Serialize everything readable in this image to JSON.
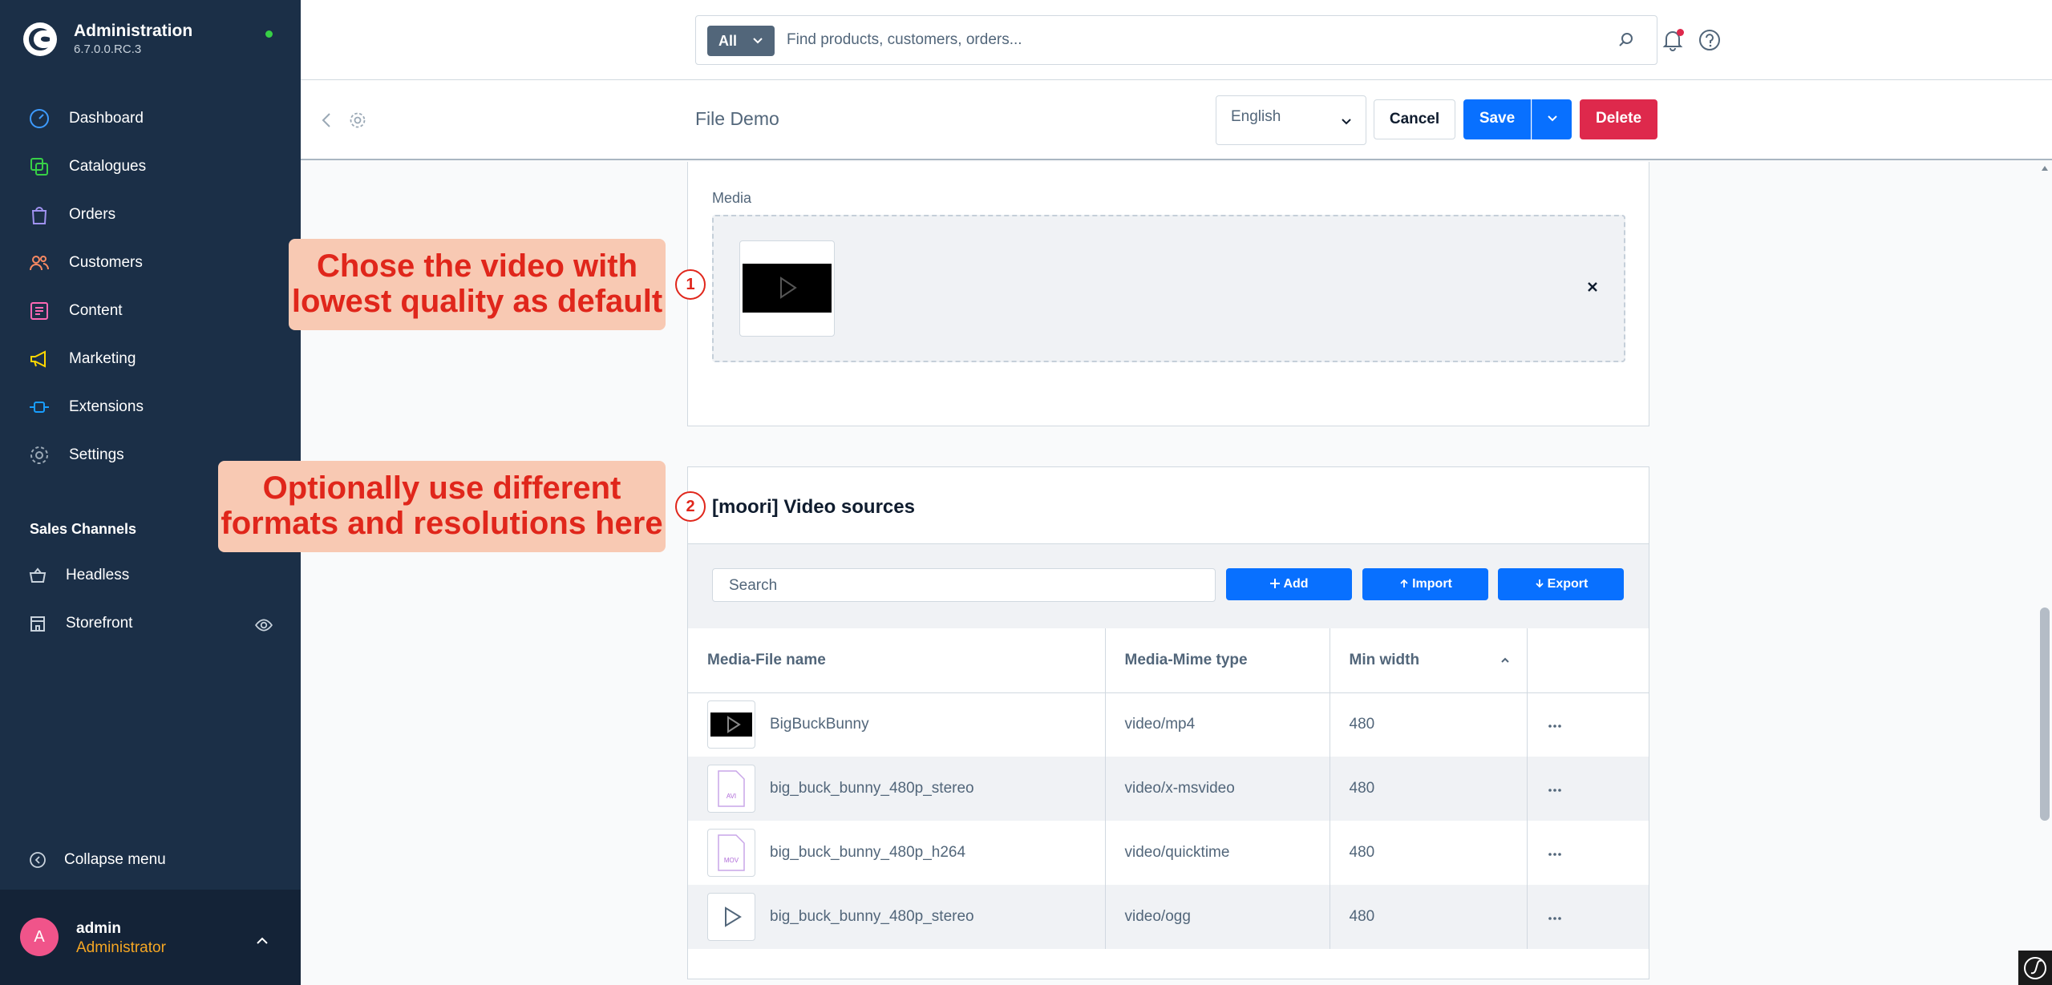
{
  "app": {
    "title": "Administration",
    "version": "6.7.0.0.RC.3"
  },
  "sidebar": {
    "items": [
      {
        "label": "Dashboard",
        "icon": "gauge-icon",
        "color": "#3d9bff"
      },
      {
        "label": "Catalogues",
        "icon": "catalogue-icon",
        "color": "#37d046"
      },
      {
        "label": "Orders",
        "icon": "bag-icon",
        "color": "#a092f0"
      },
      {
        "label": "Customers",
        "icon": "users-icon",
        "color": "#f88962"
      },
      {
        "label": "Content",
        "icon": "content-icon",
        "color": "#ff68b4"
      },
      {
        "label": "Marketing",
        "icon": "megaphone-icon",
        "color": "#ffd700"
      },
      {
        "label": "Extensions",
        "icon": "plug-icon",
        "color": "#189eff"
      },
      {
        "label": "Settings",
        "icon": "gear-icon",
        "color": "#9aa8b5"
      }
    ],
    "sales_channels_title": "Sales Channels",
    "channels": [
      {
        "label": "Headless",
        "icon": "basket-icon"
      },
      {
        "label": "Storefront",
        "icon": "storefront-icon"
      }
    ],
    "collapse_label": "Collapse menu",
    "user": {
      "initial": "A",
      "name": "admin",
      "role": "Administrator"
    }
  },
  "search": {
    "type_label": "All",
    "placeholder": "Find products, customers, orders..."
  },
  "subheader": {
    "title": "File Demo",
    "language": "English",
    "cancel_label": "Cancel",
    "save_label": "Save",
    "delete_label": "Delete"
  },
  "media": {
    "label": "Media"
  },
  "video_sources": {
    "title": "[moori] Video sources",
    "search_placeholder": "Search",
    "add_label": "Add",
    "import_label": "Import",
    "export_label": "Export",
    "columns": [
      "Media-File name",
      "Media-Mime type",
      "Min width",
      ""
    ],
    "rows": [
      {
        "name": "BigBuckBunny",
        "mime": "video/mp4",
        "min_width": "480",
        "thumb": "video-thumb-icon"
      },
      {
        "name": "big_buck_bunny_480p_stereo",
        "mime": "video/x-msvideo",
        "min_width": "480",
        "thumb": "avi-file-icon",
        "ext": "AVI"
      },
      {
        "name": "big_buck_bunny_480p_h264",
        "mime": "video/quicktime",
        "min_width": "480",
        "thumb": "mov-file-icon",
        "ext": "MOV"
      },
      {
        "name": "big_buck_bunny_480p_stereo",
        "mime": "video/ogg",
        "min_width": "480",
        "thumb": "play-icon"
      }
    ]
  },
  "annotations": {
    "callout1": "Chose the video with lowest quality as default",
    "callout2": "Optionally use different formats and resolutions here",
    "badge1": "1",
    "badge2": "2"
  },
  "colors": {
    "sidebar_bg": "#1b2f47",
    "primary": "#0870ff",
    "danger": "#de294c",
    "callout_bg": "#f8c9b3",
    "callout_text": "#e0261b"
  }
}
